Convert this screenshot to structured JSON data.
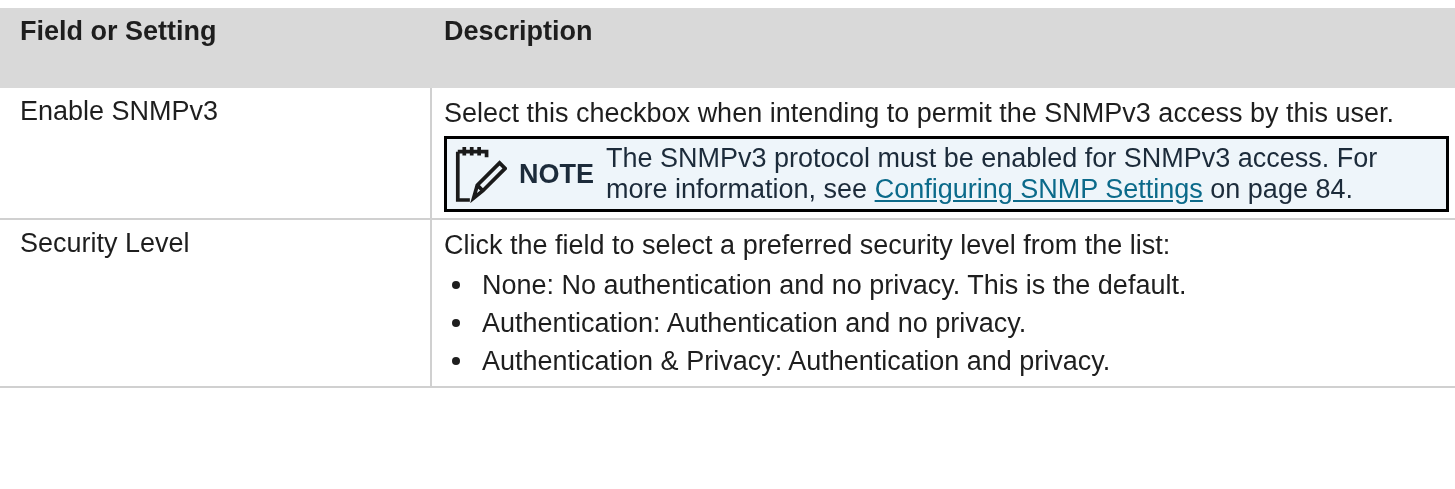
{
  "table": {
    "columns": [
      "Field or Setting",
      "Description"
    ],
    "rows": [
      {
        "field": "Enable SNMPv3",
        "description": "Select this checkbox when intending to permit the SNMPv3 access by this user.",
        "note": {
          "label": "NOTE",
          "text_before": "The SNMPv3 protocol must be enabled for SNMPv3 access. For more information, see",
          "link": "Configuring SNMP Settings",
          "text_after": "on page 84."
        }
      },
      {
        "field": "Security Level",
        "description": "Click the field to select a preferred security level from the list:",
        "bullets": [
          "None: No authentication and no privacy. This is the default.",
          "Authentication: Authentication and no privacy.",
          "Authentication & Privacy: Authentication and privacy."
        ]
      }
    ]
  }
}
